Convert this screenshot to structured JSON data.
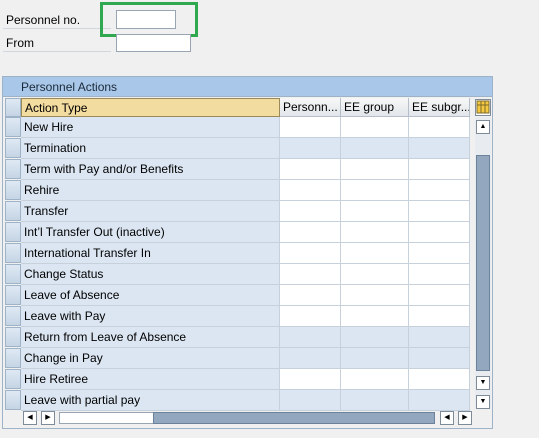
{
  "selection": {
    "personnel_no_label": "Personnel no.",
    "personnel_no_value": "",
    "from_label": "From",
    "from_value": ""
  },
  "table": {
    "title": "Personnel Actions",
    "columns": [
      "Action Type",
      "Personn...",
      "EE group",
      "EE subgr..."
    ],
    "rows": [
      "New Hire",
      "Termination",
      "Term with Pay and/or Benefits",
      "Rehire",
      "Transfer",
      "Int’l Transfer Out (inactive)",
      "International Transfer In",
      "Change Status",
      "Leave of Absence",
      "Leave with Pay",
      "Return from Leave of Absence",
      "Change in Pay",
      "Hire Retiree",
      "Leave with partial pay"
    ]
  },
  "colors": {
    "focus_highlight": "#2fa84f",
    "title_bar": "#a9c7e8",
    "action_cell": "#dbe6f2"
  },
  "icons": {
    "column_settings": "column-settings-icon",
    "scroll_up": "up-arrow-icon",
    "scroll_down": "down-arrow-icon",
    "scroll_left": "left-arrow-icon",
    "scroll_right": "right-arrow-icon"
  }
}
